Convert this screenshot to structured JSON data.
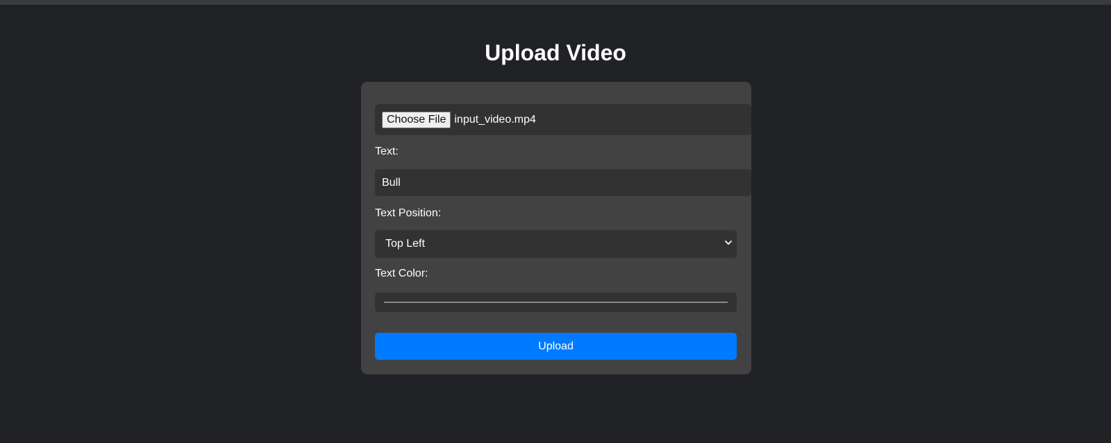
{
  "page": {
    "title": "Upload Video",
    "background_color": "#212226"
  },
  "form": {
    "file": {
      "button_label": "Choose File",
      "selected_file": "input_video.mp4"
    },
    "text": {
      "label": "Text:",
      "value": "Bull"
    },
    "position": {
      "label": "Text Position:",
      "selected": "Top Left",
      "icon": "chevron-down-icon"
    },
    "color": {
      "label": "Text Color:",
      "value": "#000000"
    },
    "submit_label": "Upload",
    "submit_color": "#007bff"
  }
}
